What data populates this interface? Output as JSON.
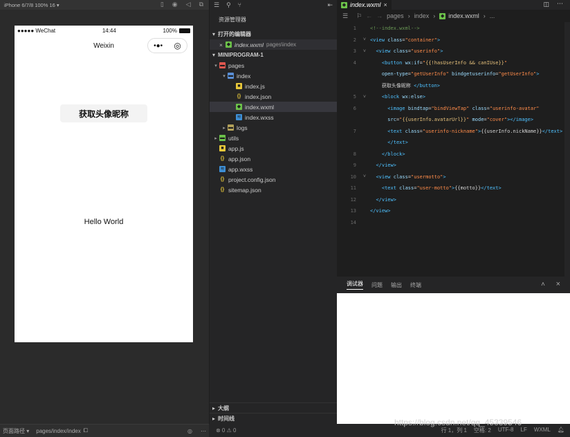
{
  "simulator": {
    "device": "iPhone 6/7/8 100% 16 ▾",
    "status_carrier": "●●●●● WeChat",
    "status_time": "14:44",
    "status_battery": "100%",
    "nav_title": "Weixin",
    "capsule_more": "•●•",
    "capsule_close": "◎",
    "get_info_button": "获取头像昵称",
    "motto": "Hello World",
    "bottom_path_label": "页面路径 ▾",
    "bottom_path": "pages/index/index"
  },
  "explorer": {
    "title": "资源管理器",
    "open_editors_label": "打开的编辑器",
    "open_editor_file": "index.wxml",
    "open_editor_path": "pages\\index",
    "project_label": "MINIPROGRAM-1",
    "tree": [
      {
        "label": "pages",
        "level": 1,
        "kind": "folder-red",
        "open": true
      },
      {
        "label": "index",
        "level": 2,
        "kind": "folder-blue",
        "open": true
      },
      {
        "label": "index.js",
        "level": 3,
        "kind": "js"
      },
      {
        "label": "index.json",
        "level": 3,
        "kind": "json"
      },
      {
        "label": "index.wxml",
        "level": 3,
        "kind": "wxml",
        "selected": true
      },
      {
        "label": "index.wxss",
        "level": 3,
        "kind": "wxss"
      },
      {
        "label": "logs",
        "level": 2,
        "kind": "folder-plain",
        "open": false
      },
      {
        "label": "utils",
        "level": 1,
        "kind": "folder-green",
        "open": false
      },
      {
        "label": "app.js",
        "level": 1,
        "kind": "js"
      },
      {
        "label": "app.json",
        "level": 1,
        "kind": "json"
      },
      {
        "label": "app.wxss",
        "level": 1,
        "kind": "wxss"
      },
      {
        "label": "project.config.json",
        "level": 1,
        "kind": "json"
      },
      {
        "label": "sitemap.json",
        "level": 1,
        "kind": "json"
      }
    ],
    "outline_label": "大纲",
    "timeline_label": "时间线",
    "problems_count": "⊗ 0 ⚠ 0"
  },
  "editor": {
    "tab_label": "index.wxml",
    "tab_close": "×",
    "breadcrumb": [
      "pages",
      "index",
      "index.wxml",
      "..."
    ],
    "lines": [
      {
        "n": "1",
        "fold": "",
        "html": "<span class=\"c\">&lt;!--index.wxml--&gt;</span>"
      },
      {
        "n": "2",
        "fold": "˅",
        "html": "<span class=\"t\">&lt;view</span> <span class=\"a\">class</span><span class=\"x\">=</span><span class=\"s\">\"container\"</span><span class=\"t\">&gt;</span>"
      },
      {
        "n": "3",
        "fold": "˅",
        "html": "  <span class=\"t\">&lt;view</span> <span class=\"a\">class</span><span class=\"x\">=</span><span class=\"s\">\"userinfo\"</span><span class=\"t\">&gt;</span>"
      },
      {
        "n": "4",
        "fold": "",
        "html": "    <span class=\"t\">&lt;button</span> <span class=\"a\">wx:if</span><span class=\"x\">=</span><span class=\"s\">\"</span><span class=\"e\">{{!hasUserInfo &amp;&amp; canIUse}}</span><span class=\"s\">\"</span>"
      },
      {
        "n": "",
        "fold": "",
        "html": "    <span class=\"a\">open-type</span><span class=\"x\">=</span><span class=\"s\">\"getUserInfo\"</span> <span class=\"a\">bindgetuserinfo</span><span class=\"x\">=</span><span class=\"s\">\"getUserInfo\"</span><span class=\"t\">&gt;</span>"
      },
      {
        "n": "",
        "fold": "",
        "html": "    <span class=\"x\">获取头像昵称 </span><span class=\"t\">&lt;/button&gt;</span>"
      },
      {
        "n": "5",
        "fold": "˅",
        "html": "    <span class=\"t\">&lt;block</span> <span class=\"a\">wx:else</span><span class=\"t\">&gt;</span>"
      },
      {
        "n": "6",
        "fold": "",
        "html": "      <span class=\"t\">&lt;image</span> <span class=\"a\">bindtap</span><span class=\"x\">=</span><span class=\"s\">\"bindViewTap\"</span> <span class=\"a\">class</span><span class=\"x\">=</span><span class=\"s\">\"userinfo-avatar\"</span>"
      },
      {
        "n": "",
        "fold": "",
        "html": "      <span class=\"a\">src</span><span class=\"x\">=</span><span class=\"s\">\"</span><span class=\"e\">{{userInfo.avatarUrl}}</span><span class=\"s\">\"</span> <span class=\"a\">mode</span><span class=\"x\">=</span><span class=\"s\">\"cover\"</span><span class=\"t\">&gt;&lt;/image&gt;</span>"
      },
      {
        "n": "7",
        "fold": "",
        "html": "      <span class=\"t\">&lt;text</span> <span class=\"a\">class</span><span class=\"x\">=</span><span class=\"s\">\"userinfo-nickname\"</span><span class=\"t\">&gt;</span><span class=\"x\">{{userInfo.nickName}}</span><span class=\"t\">&lt;/text&gt;</span>"
      },
      {
        "n": "",
        "fold": "",
        "html": "      <span class=\"t\">&lt;/text&gt;</span>"
      },
      {
        "n": "8",
        "fold": "",
        "html": "    <span class=\"t\">&lt;/block&gt;</span>"
      },
      {
        "n": "9",
        "fold": "",
        "html": "  <span class=\"t\">&lt;/view&gt;</span>"
      },
      {
        "n": "10",
        "fold": "˅",
        "html": "  <span class=\"t\">&lt;view</span> <span class=\"a\">class</span><span class=\"x\">=</span><span class=\"s\">\"usermotto\"</span><span class=\"t\">&gt;</span>"
      },
      {
        "n": "11",
        "fold": "",
        "html": "    <span class=\"t\">&lt;text</span> <span class=\"a\">class</span><span class=\"x\">=</span><span class=\"s\">\"user-motto\"</span><span class=\"t\">&gt;</span><span class=\"x\">{{motto}}</span><span class=\"t\">&lt;/text&gt;</span>"
      },
      {
        "n": "12",
        "fold": "",
        "html": "  <span class=\"t\">&lt;/view&gt;</span>"
      },
      {
        "n": "13",
        "fold": "",
        "html": "<span class=\"t\">&lt;/view&gt;</span>"
      },
      {
        "n": "14",
        "fold": "",
        "html": ""
      }
    ]
  },
  "panel": {
    "tabs": [
      "调试器",
      "问题",
      "输出",
      "终端"
    ],
    "collapse": "˄",
    "close": "×"
  },
  "statusbar": {
    "position": "行 1，列 1",
    "spaces": "空格: 2",
    "encoding": "UTF-8",
    "eol": "LF",
    "language": "WXML"
  },
  "watermark": "https://blog.csdn.net/qq_45339546"
}
